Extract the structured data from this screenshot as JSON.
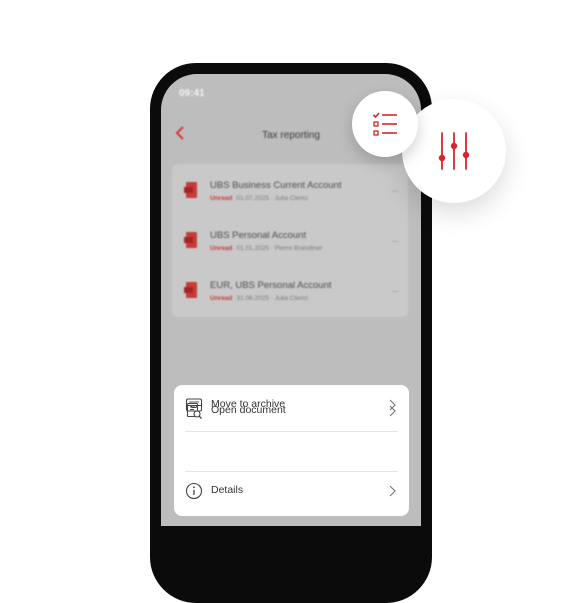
{
  "status_bar": {
    "time": "09:41",
    "icons": "▪▪ ᯤ ▭"
  },
  "header": {
    "title": "Tax reporting",
    "back_icon": "chevron-left-icon"
  },
  "documents": [
    {
      "name": "UBS Business Current Account",
      "status": "Unread",
      "meta": "01.07.2025 · Julia Clerici"
    },
    {
      "name": "UBS Personal Account",
      "status": "Unread",
      "meta": "01.01.2025 · Pierre Brandtner"
    },
    {
      "name": "EUR, UBS Personal Account",
      "status": "Unread",
      "meta": "31.06.2025 · Julia Clerici"
    }
  ],
  "more_glyph": "···",
  "action_sheet": {
    "items": [
      {
        "label": "Open document",
        "icon": "document-search-icon"
      },
      {
        "label": "Details",
        "icon": "info-icon"
      },
      {
        "label": "Move to archive",
        "icon": "archive-icon"
      }
    ]
  },
  "colors": {
    "accent": "#d9252a",
    "overlay": "#bdbdbd",
    "frame": "#0b0b0b"
  },
  "floating_buttons": [
    {
      "icon": "checklist-icon"
    },
    {
      "icon": "filter-sliders-icon"
    }
  ]
}
